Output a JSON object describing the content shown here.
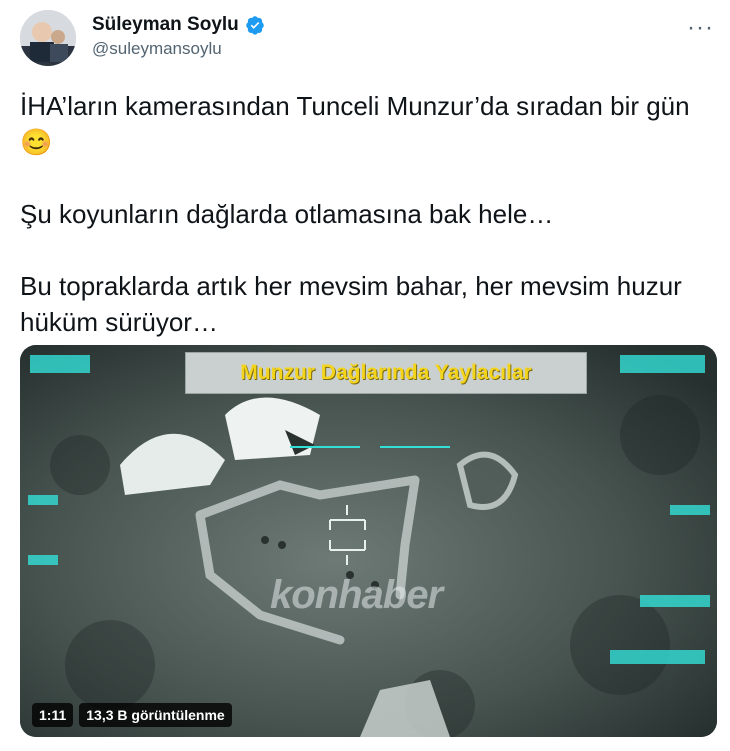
{
  "author": {
    "display_name": "Süleyman Soylu",
    "handle": "@suleymansoylu",
    "verified_icon": "verified-badge-icon",
    "avatar": "profile-photo"
  },
  "menu": {
    "more_label": "···"
  },
  "tweet": {
    "line1": "İHA’ların kamerasından Tunceli Munzur’da sıradan bir gün 😊",
    "line2": "Şu koyunların dağlarda otlamasına bak hele…",
    "line3": "Bu topraklarda artık her mevsim bahar, her mevsim huzur hüküm sürüyor…"
  },
  "media": {
    "banner_text": "Munzur Dağlarında Yaylacılar",
    "watermark_text": "konhaber",
    "duration": "1:11",
    "views": "13,3 B görüntülenme"
  },
  "colors": {
    "verified_blue": "#1d9bf0",
    "banner_yellow": "#f4d41a",
    "hud_cyan": "#33e0d8"
  }
}
